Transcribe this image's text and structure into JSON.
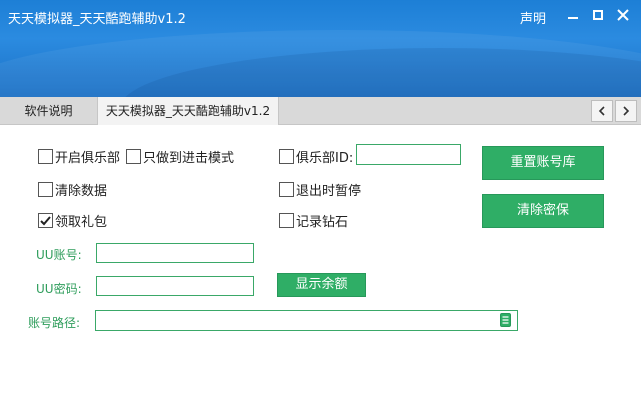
{
  "window": {
    "title": "天天模拟器_天天酷跑辅助v1.2",
    "declare_label": "声明",
    "controls": [
      "minimize-icon",
      "maximize-icon",
      "close-icon"
    ]
  },
  "tabs": [
    {
      "label": "软件说明",
      "active": false
    },
    {
      "label": "天天模拟器_天天酷跑辅助v1.2",
      "active": true
    }
  ],
  "tab_nav": [
    "chevron-left-icon",
    "chevron-right-icon"
  ],
  "options": {
    "open_club": {
      "label": "开启俱乐部",
      "checked": false
    },
    "only_advance": {
      "label": "只做到进击模式",
      "checked": false
    },
    "club_id": {
      "label": "俱乐部ID:",
      "checked": false,
      "value": ""
    },
    "clear_data": {
      "label": "清除数据",
      "checked": false
    },
    "exit_pause": {
      "label": "退出时暂停",
      "checked": false
    },
    "gift": {
      "label": "领取礼包",
      "checked": true
    },
    "record_diamond": {
      "label": "记录钻石",
      "checked": false
    }
  },
  "fields": {
    "uu_account_label": "UU账号:",
    "uu_account_value": "",
    "uu_password_label": "UU密码:",
    "uu_password_value": "",
    "account_path_label": "账号路径:",
    "account_path_value": ""
  },
  "buttons": {
    "reset_account_db": "重置账号库",
    "clear_security": "清除密保",
    "show_balance": "显示余额"
  },
  "colors": {
    "header_blue": "#1d7fd6",
    "accent_green": "#2fae66",
    "label_green": "#2e9d5b"
  }
}
